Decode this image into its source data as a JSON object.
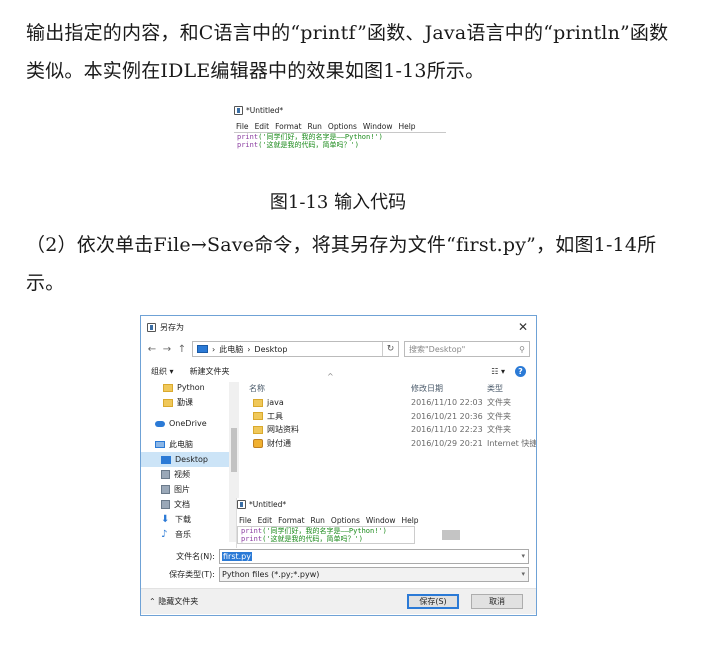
{
  "doc": {
    "para1": "输出指定的内容，和C语言中的“printf”函数、Java语言中的“println”函数类似。本实例在IDLE编辑器中的效果如图1-13所示。",
    "caption": "图1-13   输入代码",
    "para2": "（2）依次单击File→Save命令，将其另存为文件“first.py”，如图1-14所示。"
  },
  "idle": {
    "title": "*Untitled*",
    "menu": [
      "File",
      "Edit",
      "Format",
      "Run",
      "Options",
      "Window",
      "Help"
    ],
    "code": [
      {
        "kw": "print",
        "str": "('同学们好，我的名字是——Python!')"
      },
      {
        "kw": "print",
        "str": "('这就是我的代码，简单吗？')"
      }
    ]
  },
  "dialog": {
    "title": "另存为",
    "close": "✕",
    "nav_back": "←",
    "nav_forward": "→",
    "nav_up": "↑",
    "path": [
      "此电脑",
      "Desktop"
    ],
    "search_placeholder": "搜索\"Desktop\"",
    "toolbar": {
      "organize": "组织 ▾",
      "new_folder": "新建文件夹",
      "help": "?"
    },
    "nav_items": [
      {
        "label": "Python",
        "icon": "folder"
      },
      {
        "label": "勤课",
        "icon": "folder"
      },
      {
        "label": "OneDrive",
        "icon": "cloud"
      },
      {
        "label": "此电脑",
        "icon": "pc"
      },
      {
        "label": "Desktop",
        "icon": "desktop",
        "selected": true
      },
      {
        "label": "视频",
        "icon": "video"
      },
      {
        "label": "图片",
        "icon": "image"
      },
      {
        "label": "文档",
        "icon": "doc"
      },
      {
        "label": "下载",
        "icon": "download"
      },
      {
        "label": "音乐",
        "icon": "music"
      }
    ],
    "columns": {
      "name": "名称",
      "date": "修改日期",
      "type": "类型"
    },
    "files": [
      {
        "name": "java",
        "date": "2016/11/10 22:03",
        "type": "文件夹",
        "icon": "folder"
      },
      {
        "name": "工具",
        "date": "2016/10/21 20:36",
        "type": "文件夹",
        "icon": "folder"
      },
      {
        "name": "网站资料",
        "date": "2016/11/10 22:23",
        "type": "文件夹",
        "icon": "folder"
      },
      {
        "name": "财付通",
        "date": "2016/10/29 20:21",
        "type": "Internet 快捷方式",
        "icon": "shortcut"
      }
    ],
    "filename_label": "文件名(N):",
    "filename_value": "first.py",
    "filetype_label": "保存类型(T):",
    "filetype_value": "Python files (*.py;*.pyw)",
    "hide_folders": "隐藏文件夹",
    "save_button": "保存(S)",
    "cancel_button": "取消"
  }
}
